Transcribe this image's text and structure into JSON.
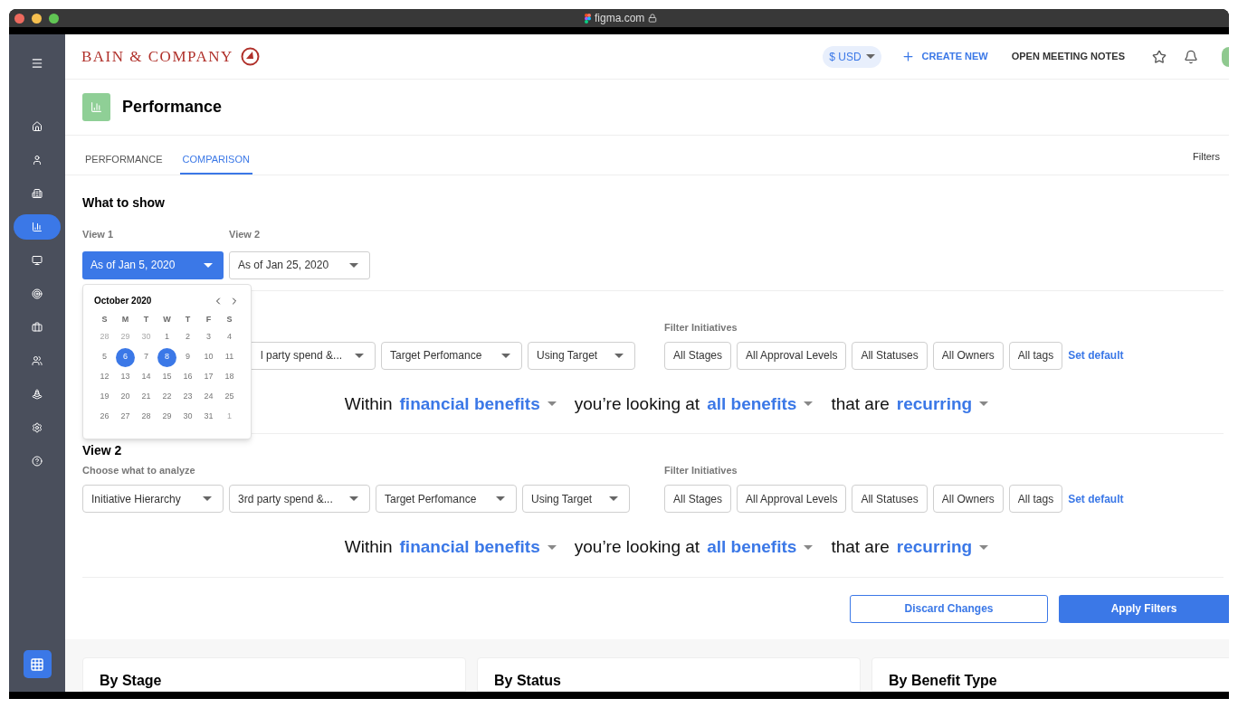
{
  "browser": {
    "url": "figma.com"
  },
  "sidebar": {
    "items": [
      {
        "selected": false
      },
      {
        "selected": false
      },
      {
        "selected": false
      },
      {
        "selected": true
      },
      {
        "selected": false
      },
      {
        "selected": false
      },
      {
        "selected": false
      },
      {
        "selected": false
      },
      {
        "selected": false
      },
      {
        "selected": false
      },
      {
        "selected": false
      }
    ]
  },
  "header": {
    "logo": "BAIN & COMPANY",
    "currency": "$ USD",
    "create": "CREATE NEW",
    "notes": "OPEN MEETING NOTES"
  },
  "page": {
    "title": "Performance"
  },
  "tabs": [
    {
      "label": "PERFORMANCE",
      "selected": false
    },
    {
      "label": "COMPARISON",
      "selected": true
    }
  ],
  "filters_label": "Filters",
  "what_to_show": {
    "title": "What to show",
    "pickers": [
      {
        "label": "View 1",
        "value": "As of Jan 5, 2020",
        "open": true
      },
      {
        "label": "View 2",
        "value": "As of Jan 25, 2020",
        "open": false
      }
    ]
  },
  "calendar": {
    "month": "October 2020",
    "weekdays": [
      "S",
      "M",
      "T",
      "W",
      "T",
      "F",
      "S"
    ],
    "days": [
      {
        "day": "28",
        "muted": true,
        "selected": false
      },
      {
        "day": "29",
        "muted": true,
        "selected": false
      },
      {
        "day": "30",
        "muted": true,
        "selected": false
      },
      {
        "day": "1",
        "muted": false,
        "selected": false
      },
      {
        "day": "2",
        "muted": false,
        "selected": false
      },
      {
        "day": "3",
        "muted": false,
        "selected": false
      },
      {
        "day": "4",
        "muted": false,
        "selected": false
      },
      {
        "day": "5",
        "muted": false,
        "selected": false
      },
      {
        "day": "6",
        "muted": false,
        "selected": true
      },
      {
        "day": "7",
        "muted": false,
        "selected": false
      },
      {
        "day": "8",
        "muted": false,
        "selected": true
      },
      {
        "day": "9",
        "muted": false,
        "selected": false
      },
      {
        "day": "10",
        "muted": false,
        "selected": false
      },
      {
        "day": "11",
        "muted": false,
        "selected": false
      },
      {
        "day": "12",
        "muted": false,
        "selected": false
      },
      {
        "day": "13",
        "muted": false,
        "selected": false
      },
      {
        "day": "14",
        "muted": false,
        "selected": false
      },
      {
        "day": "15",
        "muted": false,
        "selected": false
      },
      {
        "day": "16",
        "muted": false,
        "selected": false
      },
      {
        "day": "17",
        "muted": false,
        "selected": false
      },
      {
        "day": "18",
        "muted": false,
        "selected": false
      },
      {
        "day": "19",
        "muted": false,
        "selected": false
      },
      {
        "day": "20",
        "muted": false,
        "selected": false
      },
      {
        "day": "21",
        "muted": false,
        "selected": false
      },
      {
        "day": "22",
        "muted": false,
        "selected": false
      },
      {
        "day": "23",
        "muted": false,
        "selected": false
      },
      {
        "day": "24",
        "muted": false,
        "selected": false
      },
      {
        "day": "25",
        "muted": false,
        "selected": false
      },
      {
        "day": "26",
        "muted": false,
        "selected": false
      },
      {
        "day": "27",
        "muted": false,
        "selected": false
      },
      {
        "day": "28",
        "muted": false,
        "selected": false
      },
      {
        "day": "29",
        "muted": false,
        "selected": false
      },
      {
        "day": "30",
        "muted": false,
        "selected": false
      },
      {
        "day": "31",
        "muted": false,
        "selected": false
      },
      {
        "day": "1",
        "muted": true,
        "selected": false
      }
    ]
  },
  "views": [
    {
      "analyze": [
        "l party spend &...",
        "Target Perfomance",
        "Using Target"
      ],
      "filter_label": "Filter Initiatives",
      "filters": [
        "All Stages",
        "All Approval Levels",
        "All Statuses",
        "All Owners",
        "All tags"
      ],
      "set_default": "Set default",
      "sentence": [
        {
          "kind": "text",
          "text": "Within"
        },
        {
          "kind": "choice",
          "text": "financial benefits"
        },
        {
          "kind": "text",
          "text": "you’re looking at"
        },
        {
          "kind": "choice",
          "text": "all benefits"
        },
        {
          "kind": "text",
          "text": "that are"
        },
        {
          "kind": "choice",
          "text": "recurring"
        }
      ]
    },
    {
      "title": "View 2",
      "analyze_label": "Choose what to analyze",
      "analyze": [
        "Initiative Hierarchy",
        "3rd party spend &...",
        "Target Perfomance",
        "Using Target"
      ],
      "filter_label": "Filter Initiatives",
      "filters": [
        "All Stages",
        "All Approval Levels",
        "All Statuses",
        "All Owners",
        "All tags"
      ],
      "set_default": "Set default",
      "sentence": [
        {
          "kind": "text",
          "text": "Within"
        },
        {
          "kind": "choice",
          "text": "financial benefits"
        },
        {
          "kind": "text",
          "text": "you’re looking at"
        },
        {
          "kind": "choice",
          "text": "all benefits"
        },
        {
          "kind": "text",
          "text": "that are"
        },
        {
          "kind": "choice",
          "text": "recurring"
        }
      ]
    }
  ],
  "actions": {
    "discard": "Discard Changes",
    "apply": "Apply Filters"
  },
  "cards": [
    "By Stage",
    "By Status",
    "By Benefit Type"
  ]
}
